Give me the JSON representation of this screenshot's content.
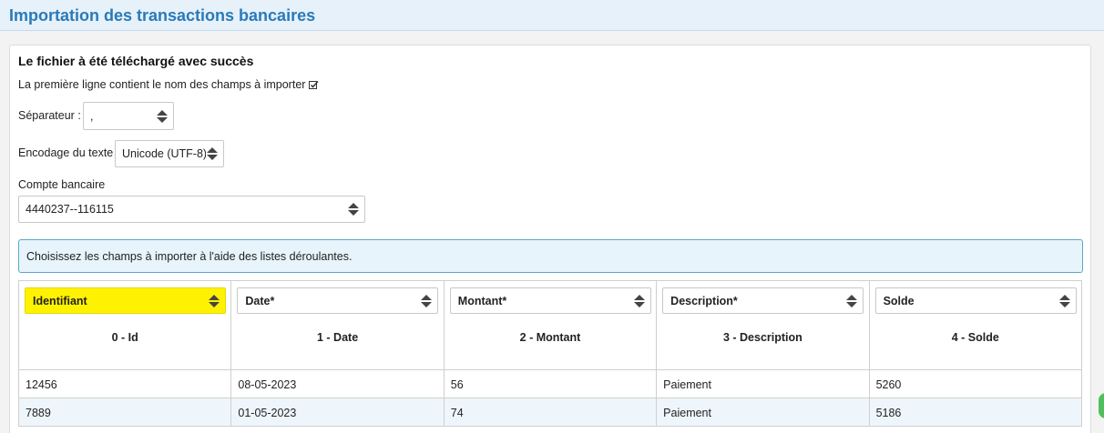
{
  "header": {
    "title": "Importation des transactions bancaires"
  },
  "form": {
    "success_message": "Le fichier à été téléchargé avec succès",
    "first_line_label": "La première ligne contient le nom des champs à importer",
    "separator": {
      "label": "Séparateur :",
      "value": ","
    },
    "encoding": {
      "label": "Encodage du texte",
      "value": "Unicode (UTF-8)"
    },
    "account": {
      "label": "Compte bancaire",
      "value": "4440237--116115"
    },
    "info": "Choisissez les champs à importer à l'aide des listes déroulantes."
  },
  "mapping": {
    "columns": [
      {
        "select": "Identifiant",
        "name": "0 - Id"
      },
      {
        "select": "Date*",
        "name": "1 - Date"
      },
      {
        "select": "Montant*",
        "name": "2 - Montant"
      },
      {
        "select": "Description*",
        "name": "3 - Description"
      },
      {
        "select": "Solde",
        "name": "4 - Solde"
      }
    ],
    "rows": [
      [
        "12456",
        "08-05-2023",
        "56",
        "Paiement",
        "5260"
      ],
      [
        "7889",
        "01-05-2023",
        "74",
        "Paiement",
        "5186"
      ]
    ]
  },
  "colors": {
    "title": "#2a7ab8",
    "highlight": "#fff200",
    "info_border": "#5aa7c8"
  },
  "icons": {
    "checkbox": "checkbox-checked-icon",
    "select": "select-arrows-icon"
  }
}
